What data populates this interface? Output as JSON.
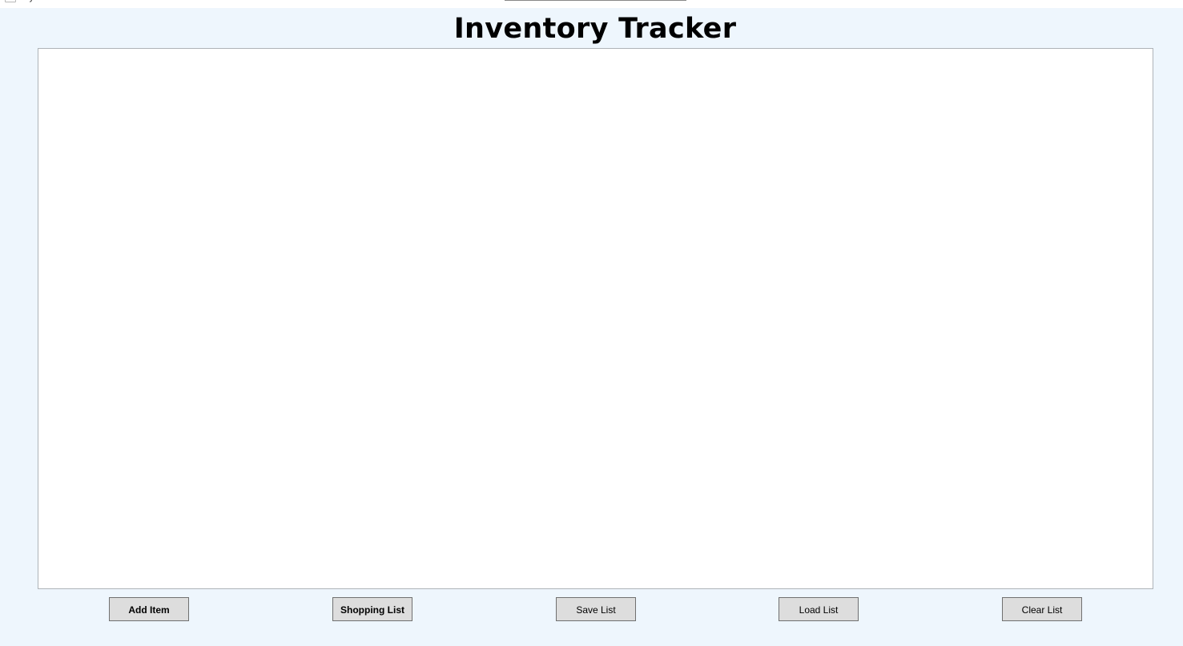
{
  "window": {
    "title_fragment": "y"
  },
  "page": {
    "title": "Inventory Tracker"
  },
  "toolbar": {
    "add_item_label": "Add Item",
    "shopping_list_label": "Shopping List",
    "save_list_label": "Save List",
    "load_list_label": "Load List",
    "clear_list_label": "Clear List"
  },
  "inventory": {
    "items": []
  },
  "colors": {
    "window_background": "#eef6fd",
    "panel_background": "#ffffff",
    "button_background": "#dddddd",
    "button_border": "#707070"
  }
}
